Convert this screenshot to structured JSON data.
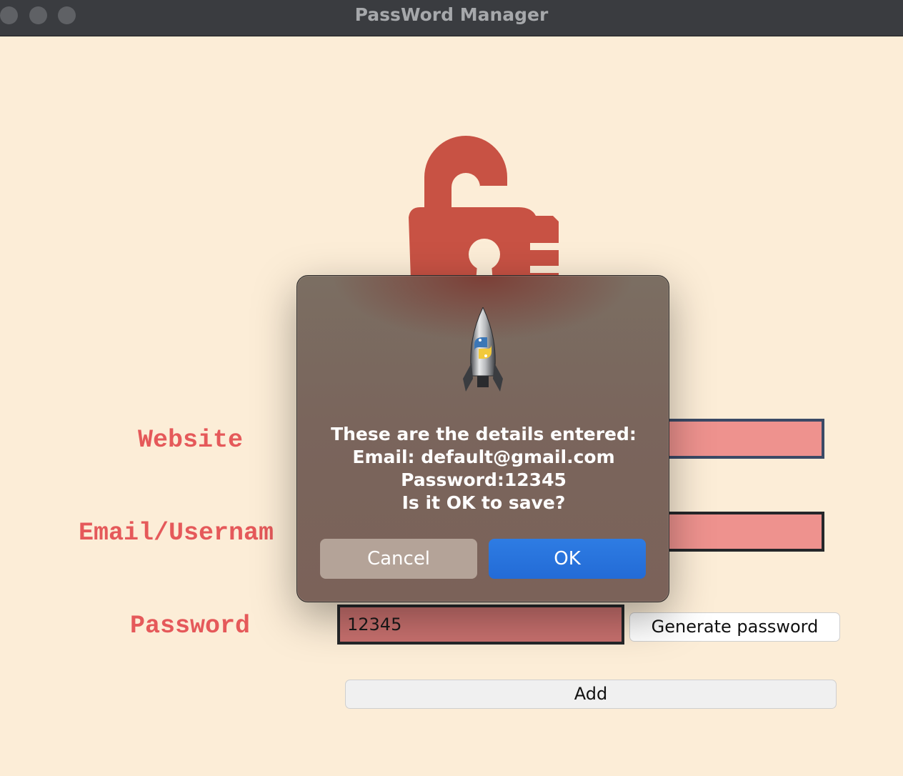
{
  "window": {
    "title": "PassWord Manager"
  },
  "form": {
    "website_label": "Website",
    "email_label": "Email/Usernam",
    "password_label": "Password",
    "website_value": "",
    "email_value": "",
    "password_value": "12345",
    "generate_button": "Generate password",
    "add_button": "Add"
  },
  "dialog": {
    "line1": "These are the details entered:",
    "line2": "Email: default@gmail.com",
    "line3": "Password:12345",
    "line4": "Is it OK to save?",
    "cancel_label": "Cancel",
    "ok_label": "OK"
  },
  "icons": {
    "logo": "lock-icon",
    "dialog_icon": "python-launcher-rocket-icon"
  },
  "colors": {
    "background": "#FCEDD7",
    "label_text": "#E5595A",
    "field_fill": "#EE928E",
    "ok_button": "#2A74DD",
    "logo": "#C85244"
  }
}
